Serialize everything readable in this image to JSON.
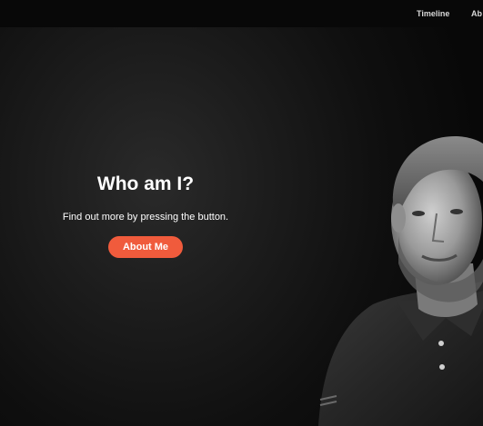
{
  "nav": {
    "links": [
      "Timeline",
      "Ab"
    ]
  },
  "hero": {
    "title": "Who am I?",
    "subtitle": "Find out more by pressing the button.",
    "button_label": "About Me"
  },
  "colors": {
    "accent": "#f05b3c",
    "background": "#0b0b0b",
    "text": "#ffffff"
  }
}
